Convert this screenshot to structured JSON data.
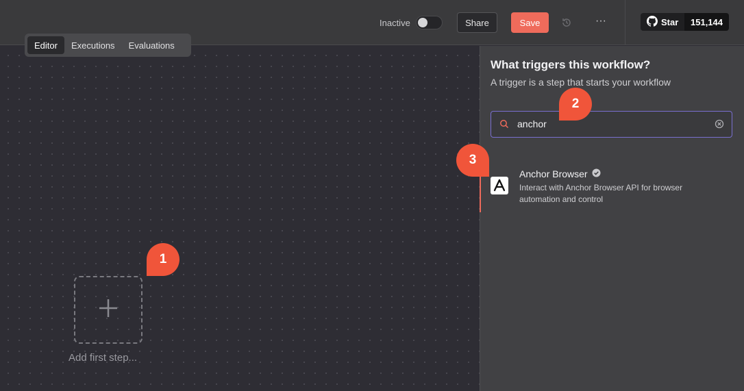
{
  "header": {
    "status_label": "Inactive",
    "share_label": "Share",
    "save_label": "Save",
    "more_label": "···",
    "github": {
      "star_label": "Star",
      "count": "151,144"
    }
  },
  "tabs": [
    {
      "label": "Editor",
      "active": true
    },
    {
      "label": "Executions",
      "active": false
    },
    {
      "label": "Evaluations",
      "active": false
    }
  ],
  "canvas": {
    "add_label": "Add first step..."
  },
  "panel": {
    "title": "What triggers this workflow?",
    "subtitle": "A trigger is a step that starts your workflow",
    "search": {
      "value": "anchor"
    },
    "results": [
      {
        "name": "Anchor Browser",
        "description": "Interact with Anchor Browser API for browser automation and control",
        "verified": true,
        "icon": "anchor-browser-logo"
      }
    ]
  },
  "markers": [
    "1",
    "2",
    "3"
  ],
  "colors": {
    "accent": "#ef6b5b",
    "marker": "#f0553a",
    "focus": "#7a6fd0"
  }
}
